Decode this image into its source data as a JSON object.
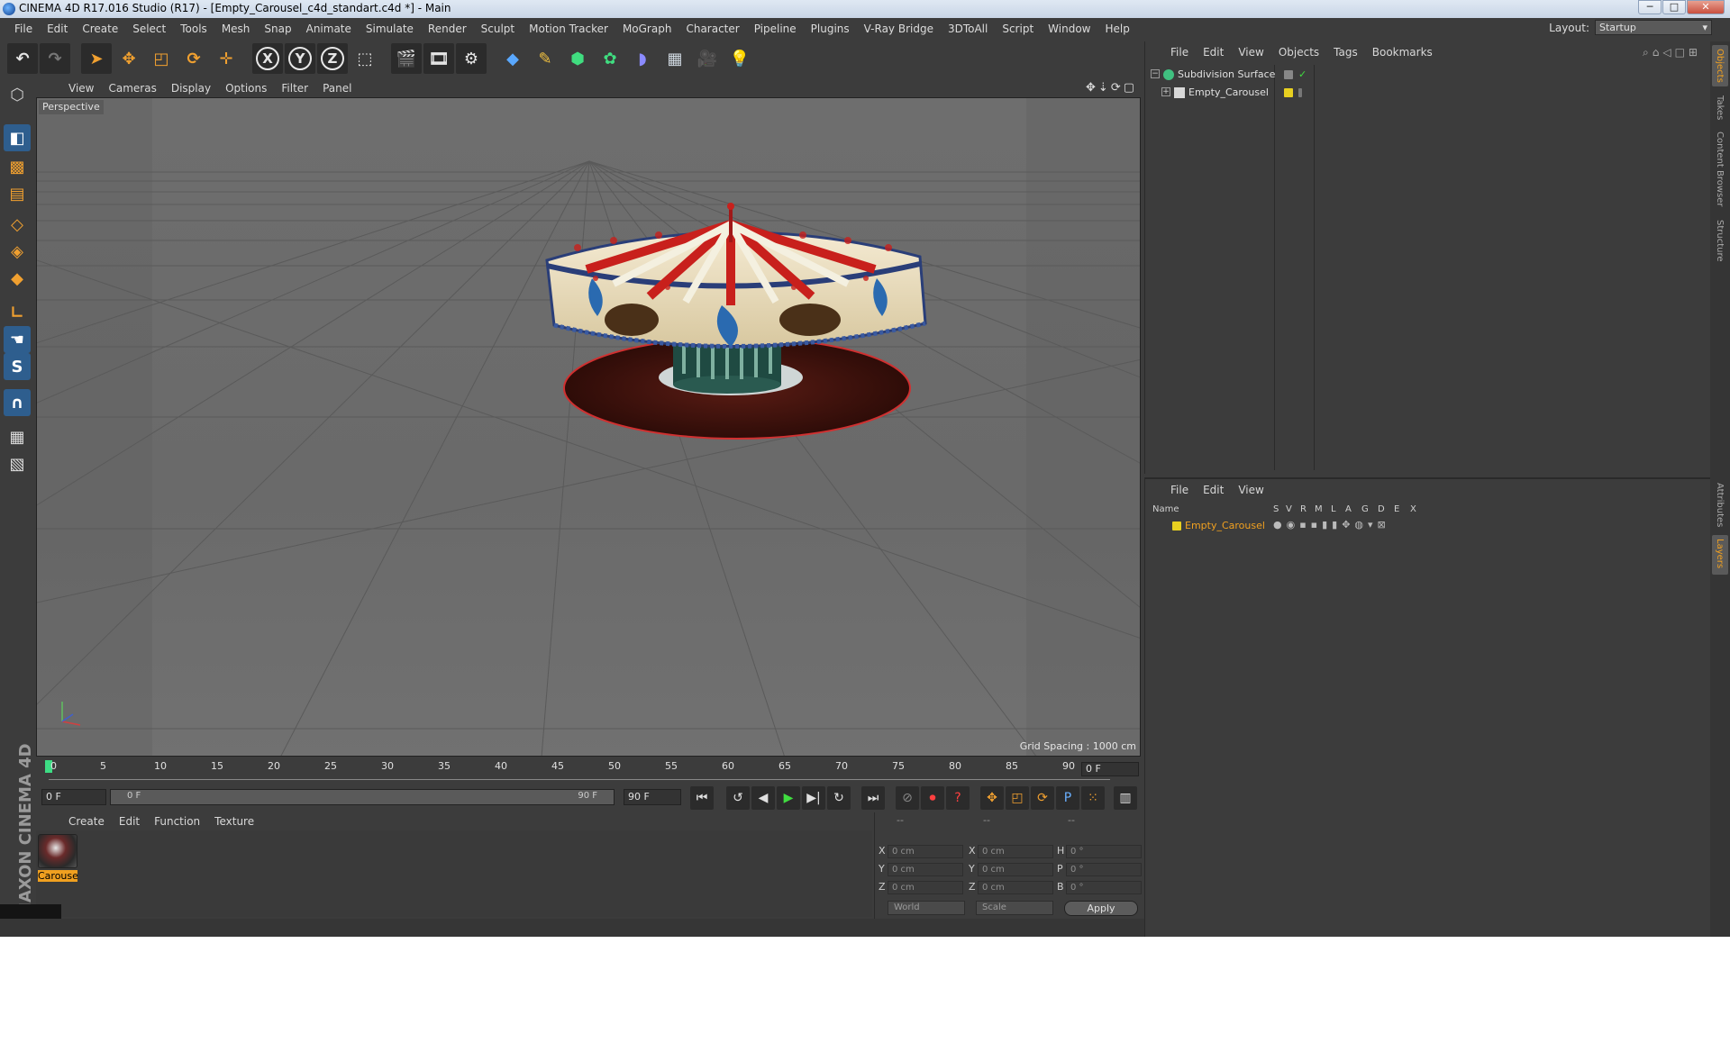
{
  "window": {
    "title": "CINEMA 4D R17.016 Studio (R17) - [Empty_Carousel_c4d_standart.c4d *] - Main",
    "minimize": "─",
    "maximize": "□",
    "close": "✕"
  },
  "menu": [
    "File",
    "Edit",
    "Create",
    "Select",
    "Tools",
    "Mesh",
    "Snap",
    "Animate",
    "Simulate",
    "Render",
    "Sculpt",
    "Motion Tracker",
    "MoGraph",
    "Character",
    "Pipeline",
    "Plugins",
    "V-Ray Bridge",
    "3DToAll",
    "Script",
    "Window",
    "Help"
  ],
  "layout": {
    "label": "Layout:",
    "value": "Startup"
  },
  "toolbar": {
    "axis_x": "X",
    "axis_y": "Y",
    "axis_z": "Z"
  },
  "viewport": {
    "menu": [
      "View",
      "Cameras",
      "Display",
      "Options",
      "Filter",
      "Panel"
    ],
    "label": "Perspective",
    "grid_spacing": "Grid Spacing : 1000 cm"
  },
  "timeline": {
    "ticks": [
      "0",
      "5",
      "10",
      "15",
      "20",
      "25",
      "30",
      "35",
      "40",
      "45",
      "50",
      "55",
      "60",
      "65",
      "70",
      "75",
      "80",
      "85",
      "90"
    ],
    "current_frame": "0 F",
    "start_field": "0 F",
    "range_start": "0 F",
    "range_end": "90 F",
    "end_field": "90 F"
  },
  "material_manager": {
    "menu": [
      "Create",
      "Edit",
      "Function",
      "Texture"
    ],
    "material_name": "Carouse"
  },
  "brand": "MAXON CINEMA 4D",
  "coordinates": {
    "headers": [
      "--",
      "--",
      "--"
    ],
    "rows": [
      {
        "a1": "X",
        "v1": "0 cm",
        "a2": "X",
        "v2": "0 cm",
        "a3": "H",
        "v3": "0 °"
      },
      {
        "a1": "Y",
        "v1": "0 cm",
        "a2": "Y",
        "v2": "0 cm",
        "a3": "P",
        "v3": "0 °"
      },
      {
        "a1": "Z",
        "v1": "0 cm",
        "a2": "Z",
        "v2": "0 cm",
        "a3": "B",
        "v3": "0 °"
      }
    ],
    "space": "World",
    "mode": "Scale",
    "apply": "Apply"
  },
  "object_manager": {
    "menu": [
      "File",
      "Edit",
      "View",
      "Objects",
      "Tags",
      "Bookmarks"
    ],
    "objects": [
      {
        "name": "Subdivision Surface"
      },
      {
        "name": "Empty_Carousel"
      }
    ]
  },
  "layer_manager": {
    "menu": [
      "File",
      "Edit",
      "View"
    ],
    "columns": [
      "Name",
      "S",
      "V",
      "R",
      "M",
      "L",
      "A",
      "G",
      "D",
      "E",
      "X"
    ],
    "layers": [
      {
        "name": "Empty_Carousel"
      }
    ]
  },
  "side_tabs": [
    "Objects",
    "Takes",
    "Content Browser",
    "Structure",
    "Attributes",
    "Layers"
  ],
  "colors": {
    "accent": "#f0a020",
    "layer_color": "#e8d020",
    "playhead": "#3ddc84"
  }
}
